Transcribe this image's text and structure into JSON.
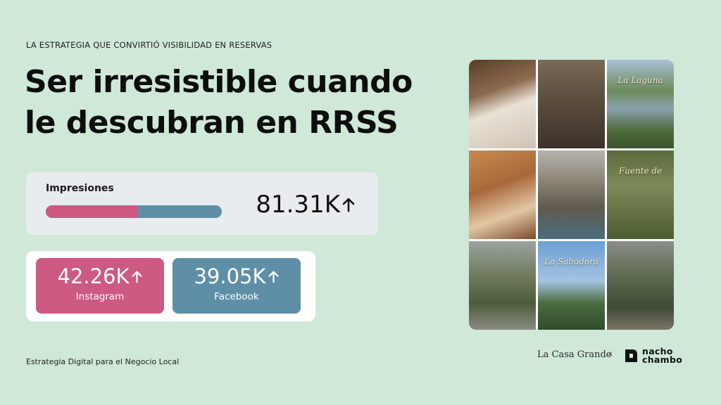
{
  "eyebrow": "LA ESTRATEGIA QUE CONVIRTIÓ VISIBILIDAD EN RESERVAS",
  "title": {
    "line1": "Ser irresistible cuando",
    "line2": "le descubran en RRSS"
  },
  "impressions": {
    "label": "Impresiones",
    "value": "81.31K",
    "arrow_icon": "arrow-up-icon",
    "split": {
      "instagram_fraction": 0.52,
      "facebook_fraction": 0.48
    }
  },
  "social": {
    "instagram": {
      "value": "42.26K",
      "label": "Instagram",
      "color": "#cc5a82"
    },
    "facebook": {
      "value": "39.05K",
      "label": "Facebook",
      "color": "#5e8fa6"
    }
  },
  "footer": "Estrategia Digital para el Negocio Local",
  "photo_grid": {
    "captions": {
      "t3": "La Laguna",
      "t6": "Fuente de",
      "t8": "La Sabadora"
    }
  },
  "brands": {
    "left": "La Casa Grande",
    "separator": "x",
    "right_line1": "nacho",
    "right_line2": "chambo"
  },
  "colors": {
    "background": "#cfe8d7",
    "instagram": "#cc5a82",
    "facebook": "#5e8fa6"
  }
}
